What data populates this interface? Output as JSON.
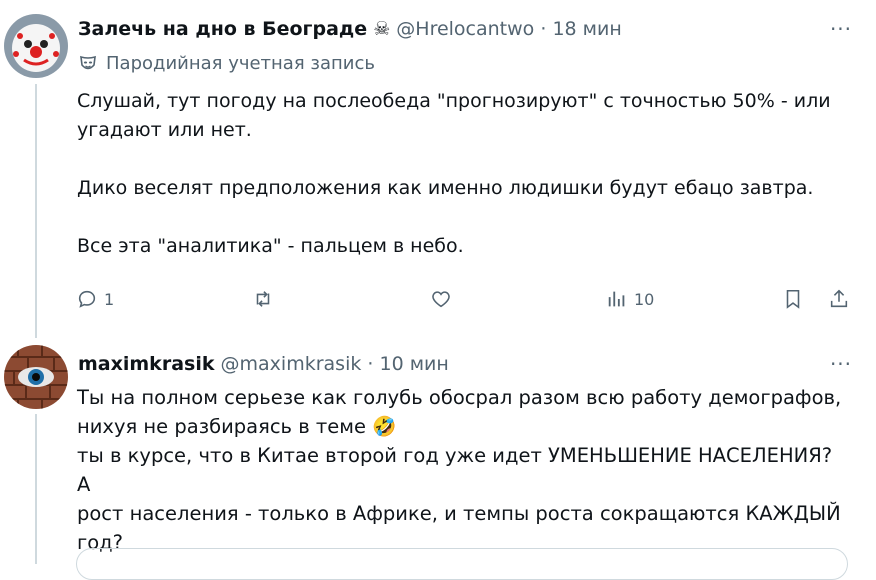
{
  "tweets": [
    {
      "author": "Залечь на дно в Београде",
      "author_emoji": "☠",
      "handle": "@Hrelocantwo",
      "dot": "·",
      "time": "18 мин",
      "label": "Пародийная учетная запись",
      "label_icon": "mask-icon",
      "paragraphs": [
        "Слушай, тут погоду на послеобеда \"прогнозируют\" с точностью 50% - или угадают или нет.",
        "Дико веселят предположения как именно людишки будут ебацо завтра.",
        "Все эта \"аналитика\" - пальцем в небо."
      ],
      "actions": {
        "reply_count": "1",
        "retweet_count": "",
        "like_count": "",
        "view_count": "10"
      }
    },
    {
      "author": "maximkrasik",
      "handle": "@maximkrasik",
      "dot": "·",
      "time": "10 мин",
      "lines": {
        "l1": "Ты на полном серьезе как голубь обосрал разом всю работу демографов,",
        "l2": "нихуя не разбираясь в теме",
        "emoji": "🤣",
        "l3": "ты в курсе, что в Китае второй год уже идет УМЕНЬШЕНИЕ НАСЕЛЕНИЯ? А",
        "l4": "рост населения - только в Африке, и темпы роста сокращаются КАЖДЫЙ",
        "l5": "год?"
      }
    }
  ],
  "more_label": "···",
  "colors": {
    "text": "#0f1419",
    "secondary": "#536471",
    "line": "#cfd9de"
  }
}
